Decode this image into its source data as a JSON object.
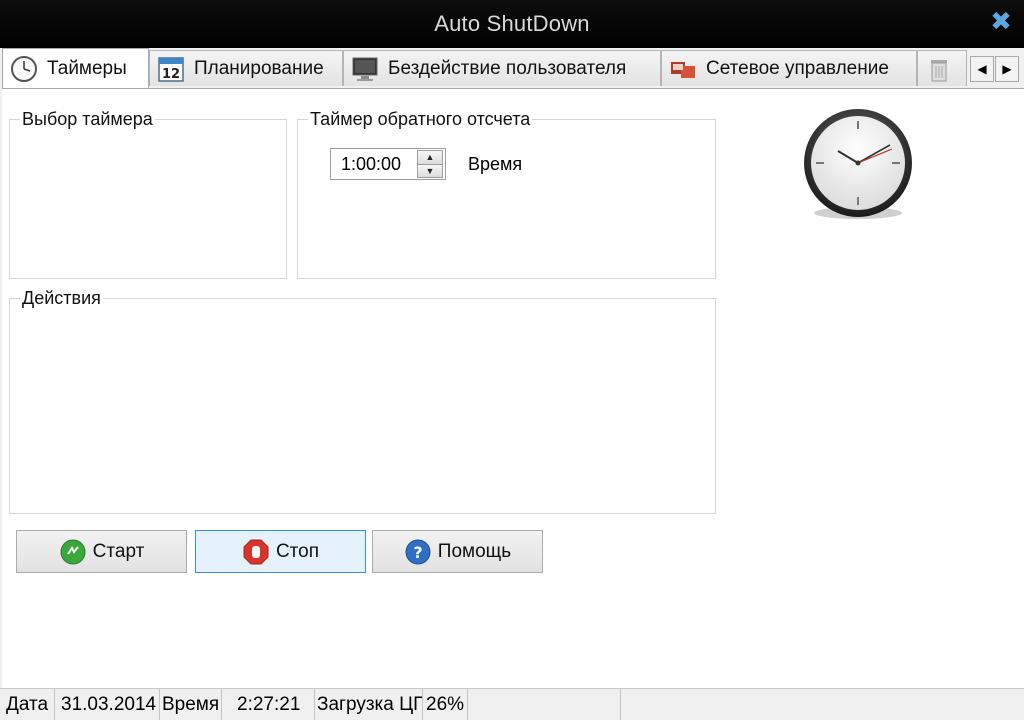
{
  "window": {
    "title": "Auto ShutDown"
  },
  "tabs": [
    {
      "label": "Таймеры",
      "icon": "clock-icon"
    },
    {
      "label": "Планирование",
      "icon": "calendar-icon"
    },
    {
      "label": "Бездействие пользователя",
      "icon": "monitor-icon"
    },
    {
      "label": "Сетевое управление",
      "icon": "network-icon"
    },
    {
      "label": "",
      "icon": "trash-icon"
    }
  ],
  "groups": {
    "timer_select": {
      "legend": "Выбор таймера"
    },
    "countdown": {
      "legend": "Таймер обратного отсчета",
      "value": "1:00:00",
      "value_label": "Время"
    },
    "actions": {
      "legend": "Действия"
    }
  },
  "buttons": {
    "start": "Старт",
    "stop": "Стоп",
    "help": "Помощь"
  },
  "statusbar": {
    "date_label": "Дата",
    "date_value": "31.03.2014",
    "time_label": "Время",
    "time_value": "2:27:21",
    "cpu_label": "Загрузка ЦП",
    "cpu_value": "26%"
  },
  "colors": {
    "accent": "#3c8fd6",
    "titlebar": "#000000",
    "close": "#5aa7e0"
  }
}
